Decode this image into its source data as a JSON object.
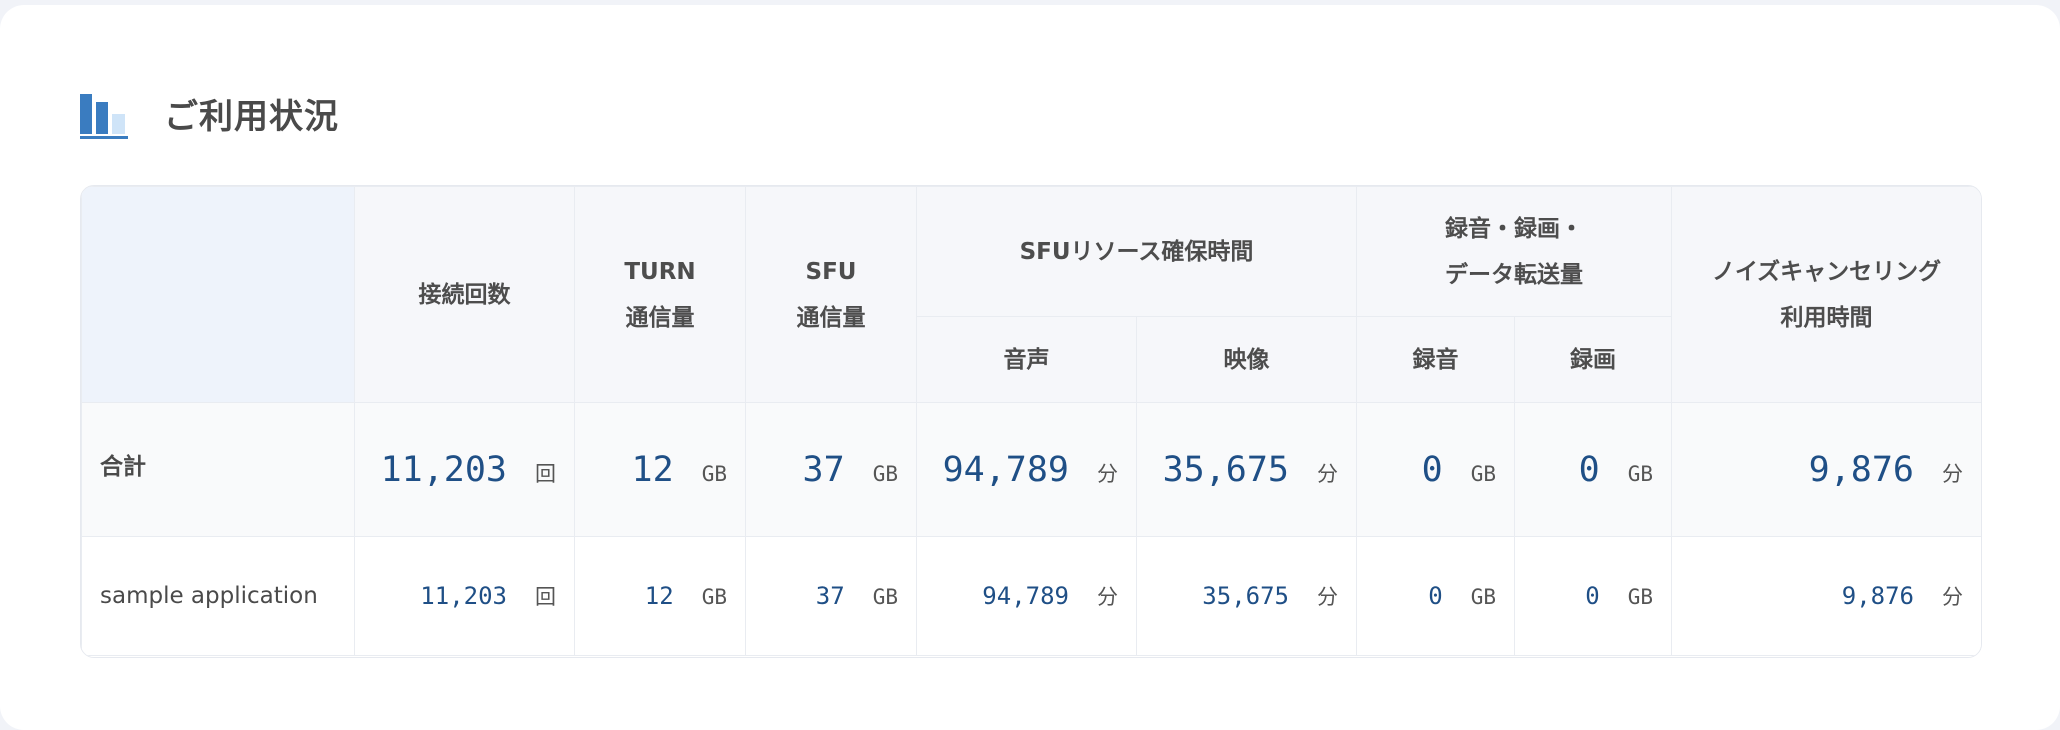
{
  "section": {
    "title": "ご利用状況",
    "icon": "bar-chart-icon"
  },
  "table": {
    "headers": {
      "connections": "接続回数",
      "turn_line1": "TURN",
      "turn_line2": "通信量",
      "sfu_line1": "SFU",
      "sfu_line2": "通信量",
      "sfu_resource": "SFUリソース確保時間",
      "audio": "音声",
      "video": "映像",
      "recording_line1": "録音・録画・",
      "recording_line2": "データ転送量",
      "rec_audio": "録音",
      "rec_video": "録画",
      "noise_line1": "ノイズキャンセリング",
      "noise_line2": "利用時間"
    },
    "units": {
      "count": "回",
      "gb": "GB",
      "minutes": "分"
    },
    "total": {
      "label": "合計",
      "connections": "11,203",
      "turn": "12",
      "sfu": "37",
      "audio": "94,789",
      "video": "35,675",
      "rec_audio": "0",
      "rec_video": "0",
      "noise": "9,876"
    },
    "rows": [
      {
        "label": "sample application",
        "connections": "11,203",
        "turn": "12",
        "sfu": "37",
        "audio": "94,789",
        "video": "35,675",
        "rec_audio": "0",
        "rec_video": "0",
        "noise": "9,876"
      }
    ]
  },
  "colors": {
    "accent": "#3a7cc0",
    "value_text": "#1f4f86",
    "header_bg": "#f6f7fa"
  }
}
